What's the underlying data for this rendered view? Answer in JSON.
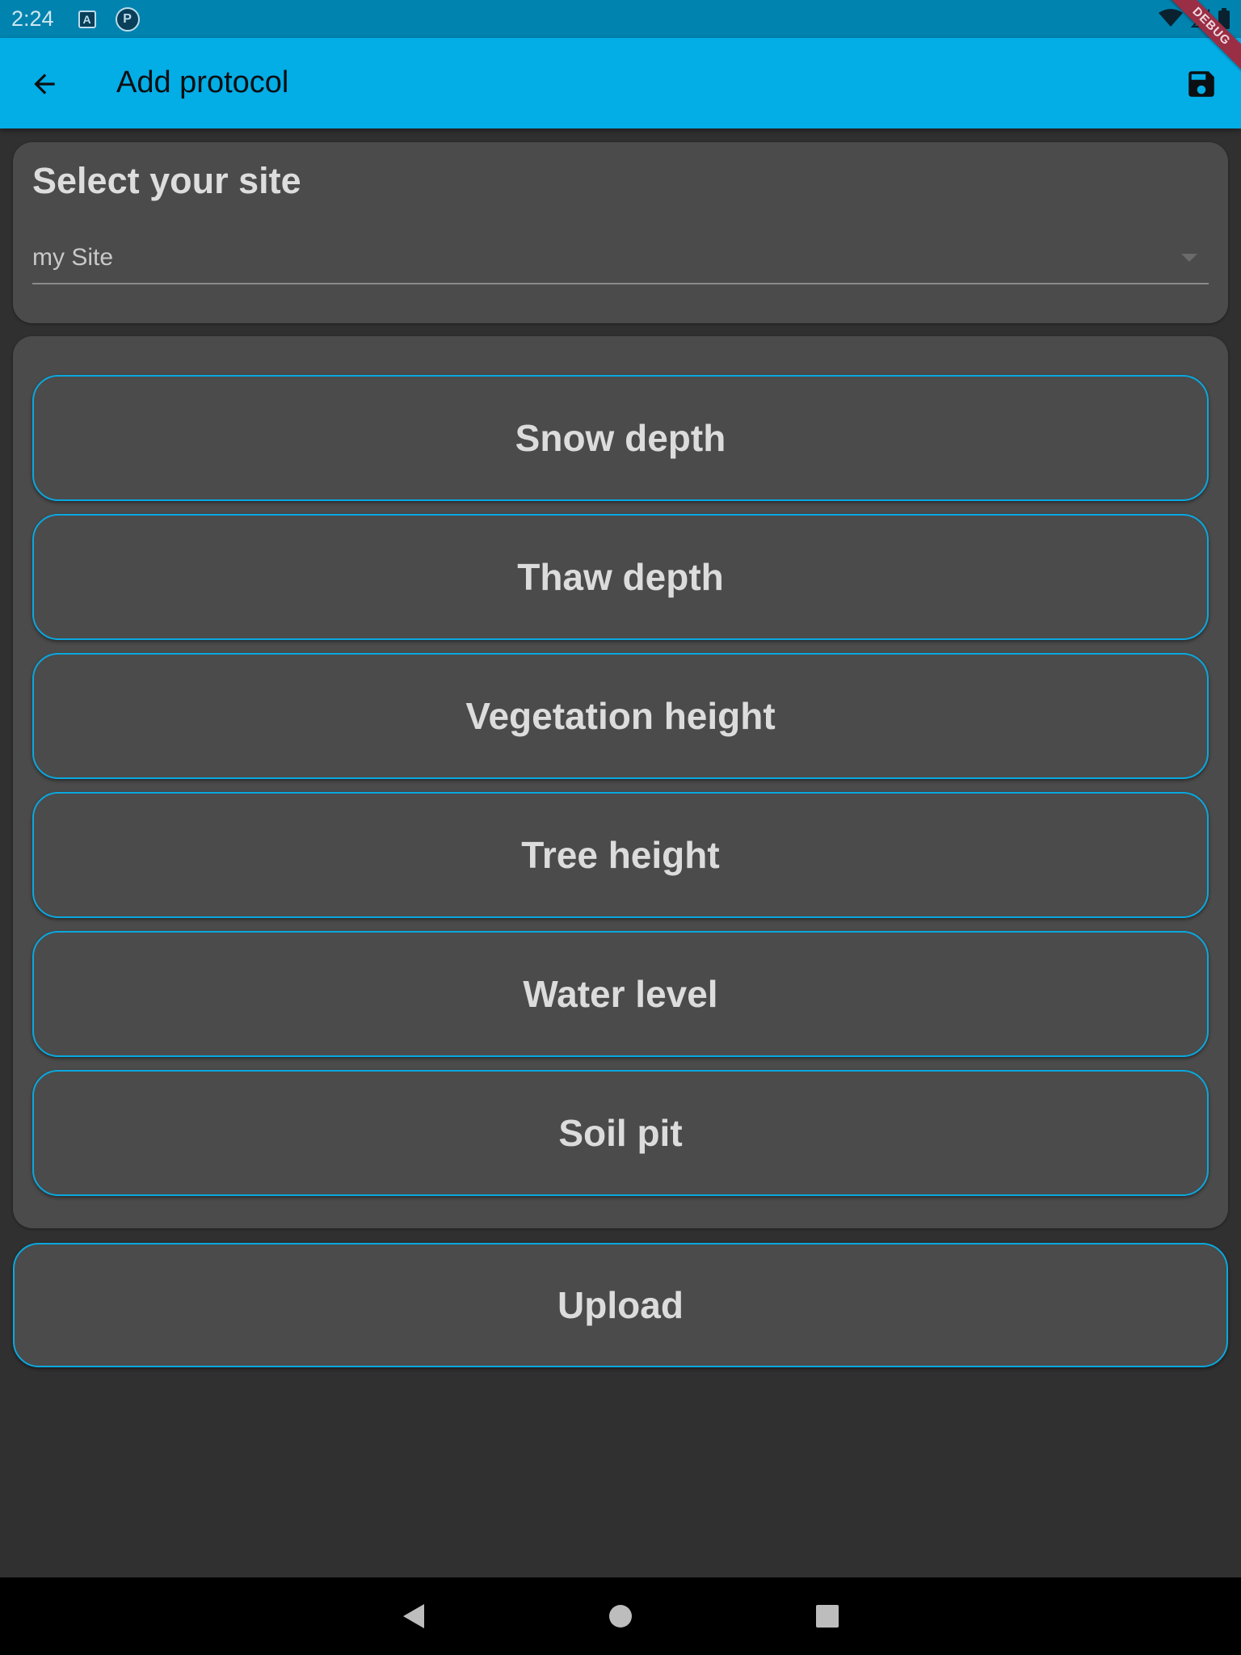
{
  "status_bar": {
    "time": "2:24",
    "icons": [
      "a-notification-icon",
      "p-notification-icon",
      "wifi-icon",
      "signal-icon",
      "battery-icon"
    ],
    "debug_label": "DEBUG"
  },
  "app_bar": {
    "title": "Add protocol",
    "background": "#03ade6",
    "back_icon": "arrow-back-icon",
    "save_icon": "save-icon"
  },
  "site_card": {
    "title": "Select your site",
    "selected_site": "my Site"
  },
  "protocols": [
    {
      "label": "Snow depth"
    },
    {
      "label": "Thaw depth"
    },
    {
      "label": "Vegetation height"
    },
    {
      "label": "Tree height"
    },
    {
      "label": "Water level"
    },
    {
      "label": "Soil pit"
    }
  ],
  "upload": {
    "label": "Upload"
  },
  "theme": {
    "accent": "#0aa8df",
    "card_background": "#4b4b4b",
    "page_background": "#303030"
  },
  "nav_bar": {
    "icons": [
      "back-triangle-icon",
      "home-circle-icon",
      "recents-square-icon"
    ]
  }
}
